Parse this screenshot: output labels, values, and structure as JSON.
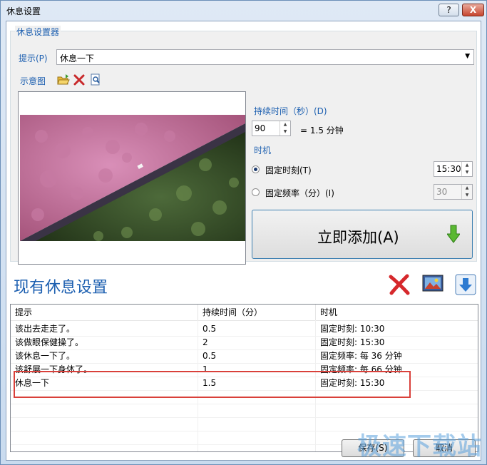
{
  "window": {
    "title": "休息设置",
    "help_label": "?",
    "close_label": "X"
  },
  "settings": {
    "group_caption": "休息设置器",
    "prompt_label": "提示(P)",
    "prompt_value": "休息一下",
    "preview_label": "示意图",
    "duration_label": "持续时间（秒）(D)",
    "duration_value": "90",
    "duration_minutes": "= 1.5 分钟",
    "timing_label": "时机",
    "fixed_time_label": "固定时刻(T)",
    "fixed_time_value": "15:30",
    "fixed_freq_label": "固定频率（分）(I)",
    "fixed_freq_value": "30",
    "add_button_label": "立即添加(A)"
  },
  "existing": {
    "title": "现有休息设置",
    "columns": [
      "提示",
      "持续时间（分）",
      "时机"
    ],
    "rows": [
      [
        "该出去走走了。",
        "0.5",
        "固定时刻: 10:30"
      ],
      [
        "该做眼保健操了。",
        "2",
        "固定时刻: 15:30"
      ],
      [
        "该休息一下了。",
        "0.5",
        "固定频率: 每 36 分钟"
      ],
      [
        "该舒展一下身体了。",
        "1",
        "固定频率: 每 66 分钟"
      ],
      [
        "休息一下",
        "1.5",
        "固定时刻: 15:30"
      ]
    ]
  },
  "footer": {
    "save_label": "保存(S)",
    "cancel_label": "取消",
    "watermark": "极速下载站"
  },
  "colors": {
    "accent_blue": "#1c5fb0",
    "highlight_red": "#d9403a",
    "add_arrow_green": "#5ab832"
  }
}
